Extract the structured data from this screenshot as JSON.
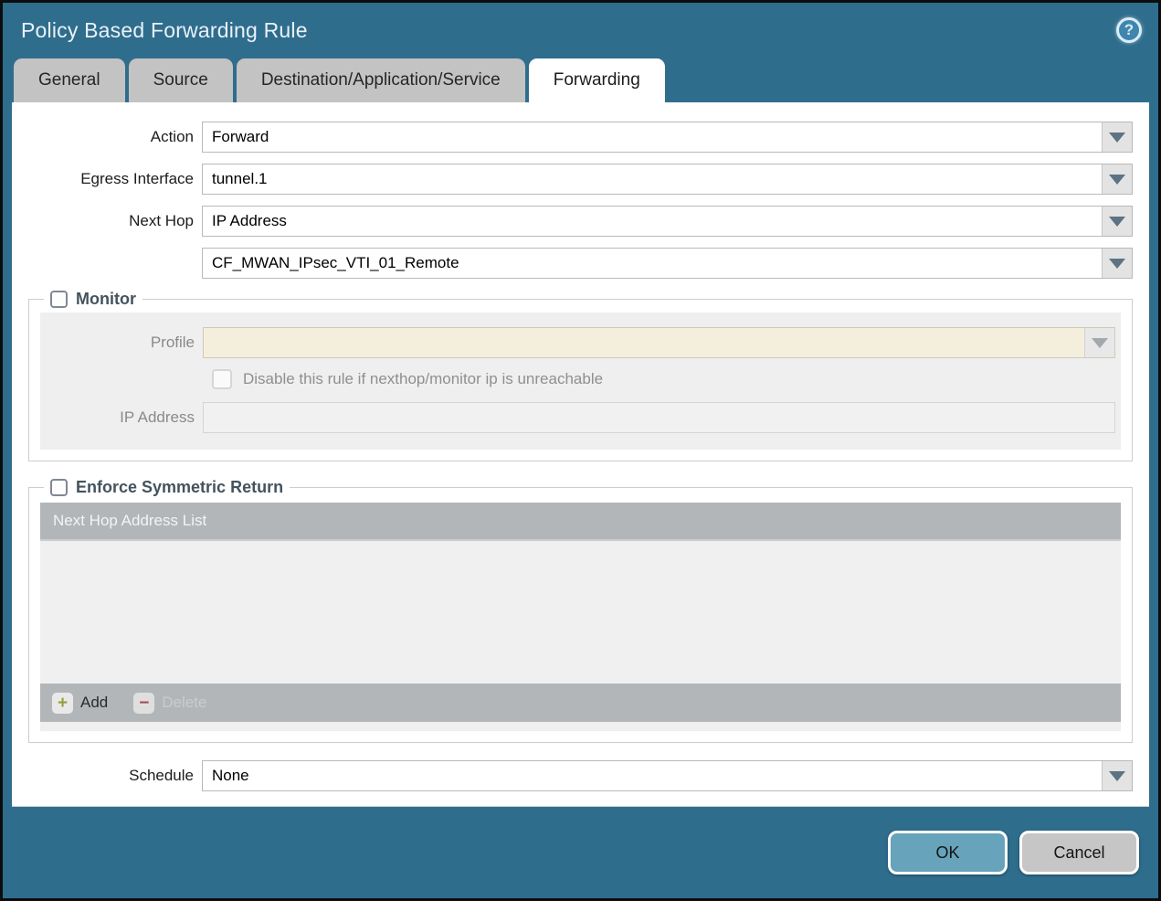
{
  "dialog": {
    "title": "Policy Based Forwarding Rule",
    "help_icon": "help-icon",
    "help_glyph": "?"
  },
  "tabs": [
    {
      "label": "General",
      "active": false
    },
    {
      "label": "Source",
      "active": false
    },
    {
      "label": "Destination/Application/Service",
      "active": false
    },
    {
      "label": "Forwarding",
      "active": true
    }
  ],
  "form": {
    "action": {
      "label": "Action",
      "value": "Forward"
    },
    "egress_interface": {
      "label": "Egress Interface",
      "value": "tunnel.1"
    },
    "next_hop": {
      "label": "Next Hop",
      "value": "IP Address"
    },
    "next_hop_address": {
      "value": "CF_MWAN_IPsec_VTI_01_Remote"
    },
    "schedule": {
      "label": "Schedule",
      "value": "None"
    }
  },
  "monitor": {
    "legend": "Monitor",
    "checked": false,
    "profile": {
      "label": "Profile",
      "value": ""
    },
    "disable_rule": {
      "label": "Disable this rule if nexthop/monitor ip is unreachable",
      "checked": false
    },
    "ip_address": {
      "label": "IP Address",
      "value": ""
    }
  },
  "symmetric_return": {
    "legend": "Enforce Symmetric Return",
    "checked": false,
    "table": {
      "header": "Next Hop Address List",
      "rows": []
    },
    "add_label": "Add",
    "delete_label": "Delete",
    "add_icon": "+",
    "delete_icon": "−"
  },
  "footer": {
    "ok_label": "OK",
    "cancel_label": "Cancel"
  },
  "colors": {
    "titlebar_teal": "#2f6d8d",
    "ok_button": "#67a3bb",
    "cancel_button": "#c6c6c6",
    "disabled_field_beige": "#f4eedd",
    "table_header_gray": "#b2b6b9"
  }
}
